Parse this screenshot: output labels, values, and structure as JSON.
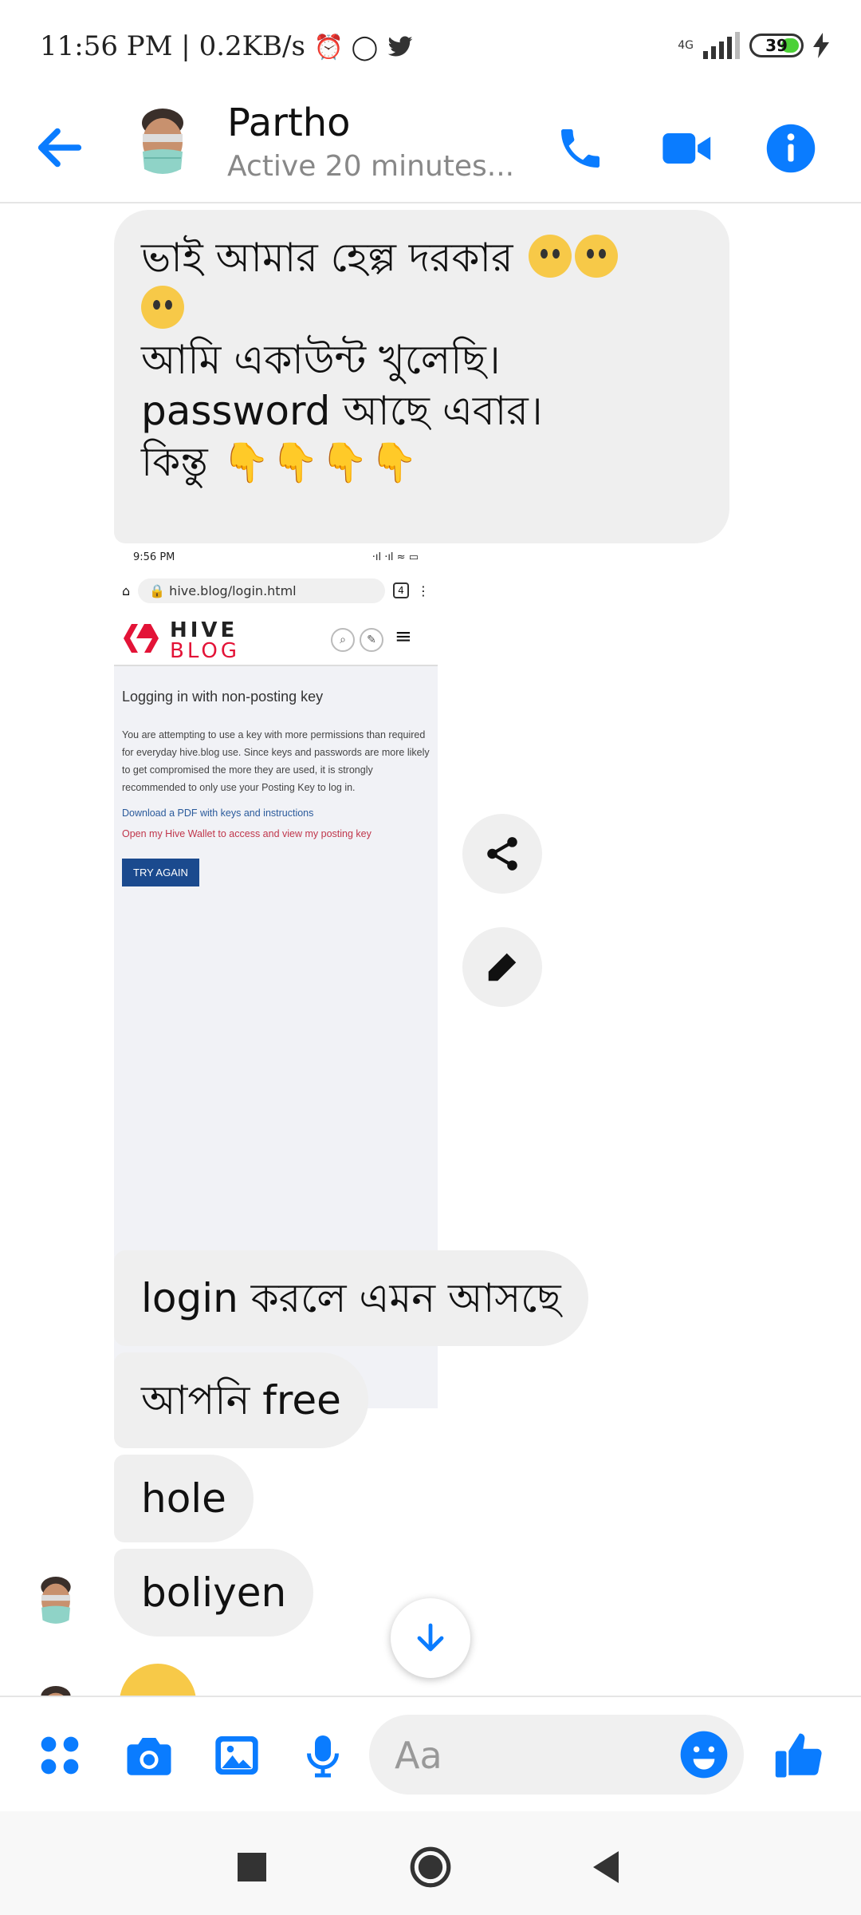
{
  "status_bar": {
    "time": "11:56 PM",
    "net_speed": "0.2KB/s",
    "network": "4G",
    "battery": "39"
  },
  "header": {
    "contact_name": "Partho",
    "contact_status": "Active 20 minutes...",
    "accent_color": "#0a7cff"
  },
  "messages": {
    "m1_line1": "ভাই আমার হেল্প দরকার",
    "m1_line3": "আমি একাউন্ট খুলেছি।",
    "m1_line4": "password আছে এবার।",
    "m1_line5": "কিন্তু",
    "m2": "login করলে এমন আসছে",
    "m3": "আপনি free",
    "m4": "hole",
    "m5": "boliyen"
  },
  "attachment": {
    "time": "9:56 PM",
    "url": "hive.blog/login.html",
    "tab_count": "4",
    "brand_line1": "HIVE",
    "brand_line2": "BLOG",
    "heading": "Logging in with non-posting key",
    "paragraph": "You are attempting to use a key with more permissions than required for everyday hive.blog use. Since keys and passwords are more likely to get compromised the more they are used, it is strongly recommended to only use your Posting Key to log in.",
    "link_pdf": "Download a PDF with keys and instructions",
    "link_wallet": "Open my Hive Wallet to access and view my posting key",
    "button": "TRY AGAIN"
  },
  "composer": {
    "placeholder": "Aa"
  }
}
